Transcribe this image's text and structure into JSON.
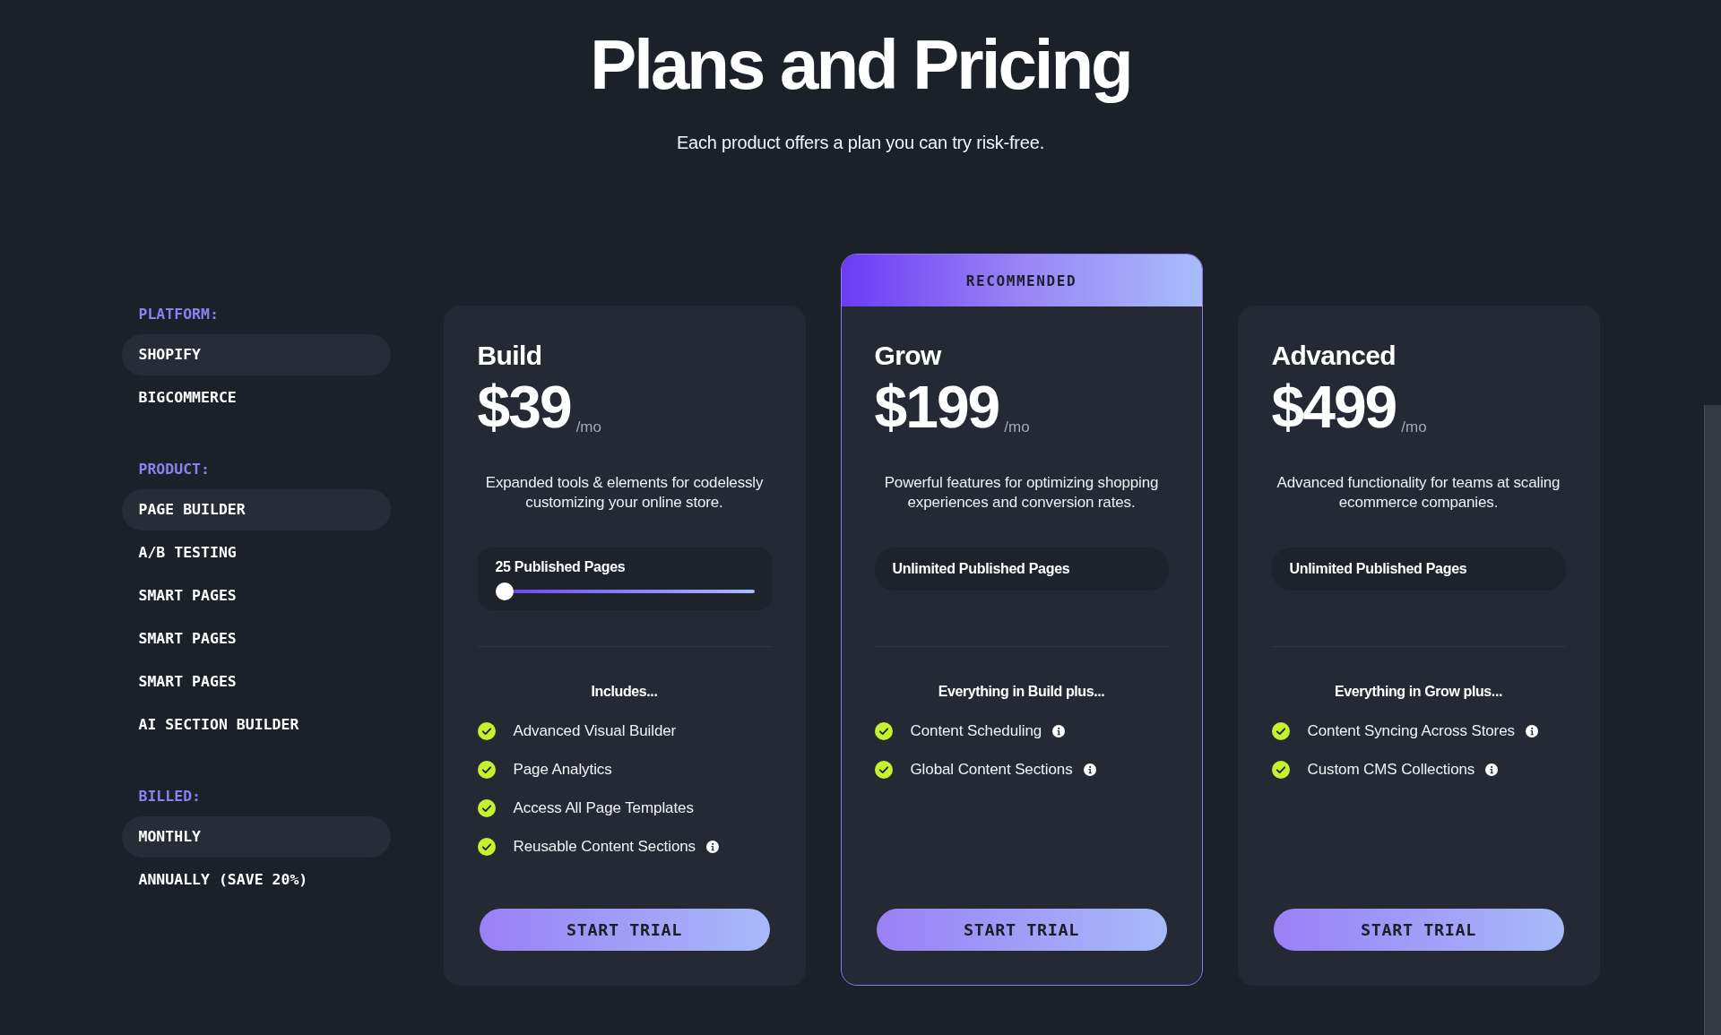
{
  "header": {
    "title": "Plans and Pricing",
    "subtitle": "Each product offers a plan you can try risk-free."
  },
  "filters": [
    {
      "label": "PLATFORM:",
      "options": [
        {
          "label": "SHOPIFY",
          "selected": true
        },
        {
          "label": "BIGCOMMERCE",
          "selected": false
        }
      ]
    },
    {
      "label": "PRODUCT:",
      "options": [
        {
          "label": "PAGE BUILDER",
          "selected": true
        },
        {
          "label": "A/B TESTING",
          "selected": false
        },
        {
          "label": "SMART PAGES",
          "selected": false
        },
        {
          "label": "SMART PAGES",
          "selected": false
        },
        {
          "label": "SMART PAGES",
          "selected": false
        },
        {
          "label": "AI SECTION BUILDER",
          "selected": false
        }
      ]
    },
    {
      "label": "BILLED:",
      "options": [
        {
          "label": "MONTHLY",
          "selected": true
        },
        {
          "label": "ANNUALLY (SAVE 20%)",
          "selected": false
        }
      ]
    }
  ],
  "plans": [
    {
      "name": "Build",
      "price": "$39",
      "period": "/mo",
      "recommended": false,
      "description": "Expanded tools & elements for codelessly customizing your online store.",
      "pages": {
        "kind": "slider",
        "label": "25 Published Pages",
        "level": 0
      },
      "features_heading": "Includes...",
      "features": [
        {
          "label": "Advanced Visual Builder",
          "info": false
        },
        {
          "label": "Page Analytics",
          "info": false
        },
        {
          "label": "Access All Page Templates",
          "info": false
        },
        {
          "label": "Reusable Content Sections",
          "info": true
        }
      ],
      "button": "START TRIAL"
    },
    {
      "name": "Grow",
      "price": "$199",
      "period": "/mo",
      "recommended": true,
      "badge": "RECOMMENDED",
      "description": "Powerful features for optimizing shopping experiences and conversion rates.",
      "pages": {
        "kind": "label",
        "label": "Unlimited Published Pages"
      },
      "features_heading": "Everything in Build plus...",
      "features": [
        {
          "label": "Content Scheduling",
          "info": true
        },
        {
          "label": "Global Content Sections",
          "info": true
        }
      ],
      "button": "START TRIAL"
    },
    {
      "name": "Advanced",
      "price": "$499",
      "period": "/mo",
      "recommended": false,
      "description": "Advanced functionality for teams at scaling ecommerce companies.",
      "pages": {
        "kind": "label",
        "label": "Unlimited Published Pages"
      },
      "features_heading": "Everything in Grow plus...",
      "features": [
        {
          "label": "Content Syncing Across Stores",
          "info": true
        },
        {
          "label": "Custom CMS Collections",
          "info": true
        }
      ],
      "button": "START TRIAL"
    }
  ]
}
